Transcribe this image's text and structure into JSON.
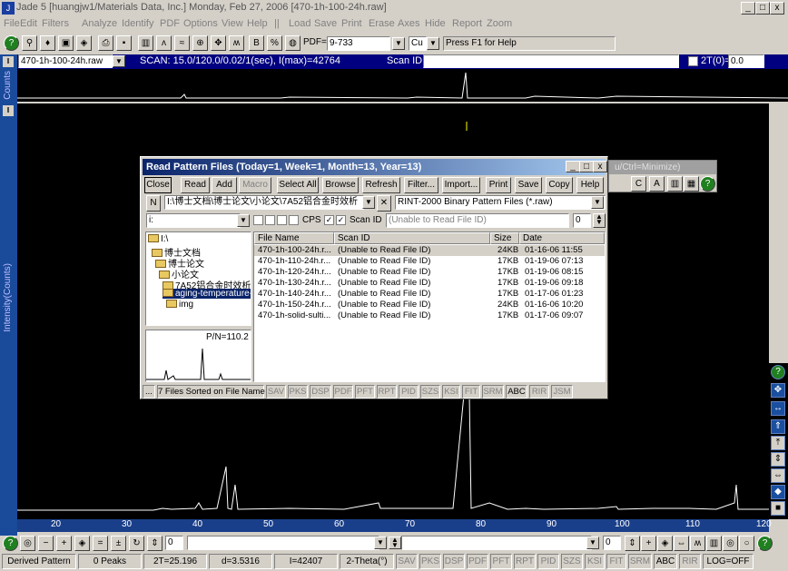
{
  "window": {
    "title": "Jade 5 [huangjw1/Materials Data, Inc.] Monday, Feb 27, 2006 [470-1h-100-24h.raw]",
    "min": "_",
    "max": "□",
    "close": "x"
  },
  "menu": [
    "File",
    "Edit",
    "Filters",
    "Analyze",
    "Identify",
    "PDF",
    "Options",
    "View",
    "Help",
    "||",
    "Load",
    "Save",
    "Print",
    "Erase",
    "Axes",
    "Hide",
    "Report",
    "Zoom"
  ],
  "toolbar": {
    "pdf_label": "PDF=",
    "pdf_value": "9-733",
    "element": "Cu",
    "hint": "Press F1 for Help"
  },
  "scanbar": {
    "file": "470-1h-100-24h.raw",
    "scan": "SCAN: 15.0/120.0/0.02/1(sec), I(max)=42764",
    "scan_id_label": "Scan ID:",
    "two_theta_label": "2T(0)=",
    "two_theta_value": "0.0"
  },
  "plot": {
    "y_label": "Intensity(Counts)",
    "top_label": "Counts",
    "x_ticks": [
      "20",
      "30",
      "40",
      "50",
      "60",
      "70",
      "80",
      "90",
      "100",
      "110",
      "120"
    ]
  },
  "dialog": {
    "title": "Read Pattern Files (Today=1, Week=1, Month=13, Year=13)",
    "buttons": [
      "Close",
      "Read",
      "Add",
      "Macro",
      "Select All",
      "Browse",
      "Refresh",
      "Filter...",
      "Import...",
      "Print",
      "Save",
      "Copy",
      "Help"
    ],
    "path": "I:\\博士文档\\博士论文\\小论文\\7A52铝合金时效析",
    "n_label": "N",
    "filter": "RINT-2000 Binary Pattern Files (*.raw)",
    "drive": "i:",
    "cps_label": "CPS",
    "scanid_label": "Scan ID",
    "scanid_value": "(Unable to Read File ID)",
    "count": "0",
    "tree": [
      "I:\\",
      "博士文档",
      "博士论文",
      "小论文",
      "7A52铝合金时效析",
      "aging-temperature-X",
      "img"
    ],
    "preview_label": "P/N=110.2",
    "columns": [
      "File Name",
      "Scan ID",
      "Size",
      "Date"
    ],
    "files": [
      {
        "name": "470-1h-100-24h.r...",
        "id": "(Unable to Read File ID)",
        "size": "24KB",
        "date": "01-16-06 11:55"
      },
      {
        "name": "470-1h-110-24h.r...",
        "id": "(Unable to Read File ID)",
        "size": "17KB",
        "date": "01-19-06 07:13"
      },
      {
        "name": "470-1h-120-24h.r...",
        "id": "(Unable to Read File ID)",
        "size": "17KB",
        "date": "01-19-06 08:15"
      },
      {
        "name": "470-1h-130-24h.r...",
        "id": "(Unable to Read File ID)",
        "size": "17KB",
        "date": "01-19-06 09:18"
      },
      {
        "name": "470-1h-140-24h.r...",
        "id": "(Unable to Read File ID)",
        "size": "17KB",
        "date": "01-17-06 01:23"
      },
      {
        "name": "470-1h-150-24h.r...",
        "id": "(Unable to Read File ID)",
        "size": "24KB",
        "date": "01-16-06 10:20"
      },
      {
        "name": "470-1h-solid-sulti...",
        "id": "(Unable to Read File ID)",
        "size": "17KB",
        "date": "01-17-06 09:07"
      }
    ],
    "status_main": "7 Files Sorted on File Name",
    "status_dots": "...",
    "status_tags": [
      "SAV",
      "PKS",
      "DSP",
      "PDF",
      "PFT",
      "RPT",
      "PID",
      "SZS",
      "KSI",
      "FIT",
      "SRM",
      "ABC",
      "RIR",
      "JSM"
    ]
  },
  "ghost_title": "u/Ctrl=Minimize)",
  "statusbar": {
    "items": [
      "Derived Pattern",
      "0 Peaks",
      "2T=25.196",
      "d=3.5316",
      "I=42407",
      "2-Theta(°)"
    ],
    "tags": [
      "SAV",
      "PKS",
      "DSP",
      "PDF",
      "PFT",
      "RPT",
      "PID",
      "SZS",
      "KSI",
      "FIT",
      "SRM",
      "ABC",
      "RIR",
      "LOG=OFF"
    ]
  },
  "bottomtb": {
    "value": "0",
    "value2": "0"
  }
}
